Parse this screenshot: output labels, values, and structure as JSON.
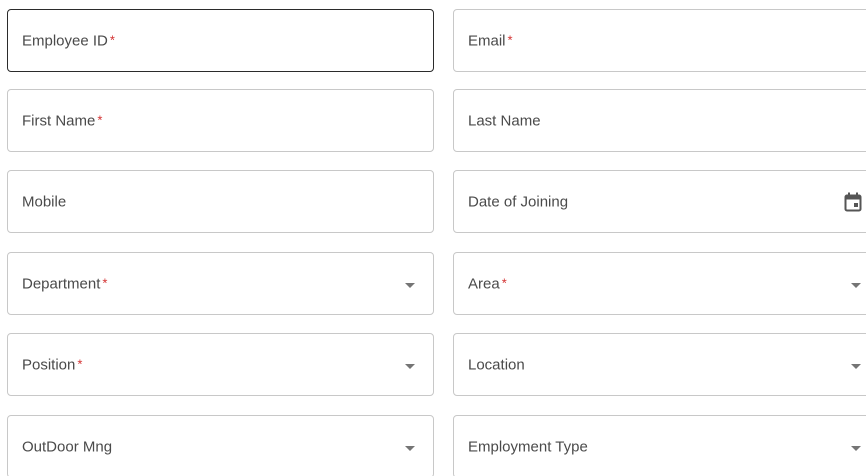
{
  "form": {
    "required_marker": "*",
    "fields": {
      "employee_id": {
        "label": "Employee ID",
        "required": true
      },
      "email": {
        "label": "Email",
        "required": true
      },
      "first_name": {
        "label": "First Name",
        "required": true
      },
      "last_name": {
        "label": "Last Name",
        "required": false
      },
      "mobile": {
        "label": "Mobile",
        "required": false
      },
      "date_of_joining": {
        "label": "Date of Joining",
        "required": false,
        "icon": "calendar-icon"
      },
      "department": {
        "label": "Department",
        "required": true,
        "icon": "dropdown-arrow-icon"
      },
      "area": {
        "label": "Area",
        "required": true,
        "icon": "dropdown-arrow-icon"
      },
      "position": {
        "label": "Position",
        "required": true,
        "icon": "dropdown-arrow-icon"
      },
      "location": {
        "label": "Location",
        "required": false,
        "icon": "dropdown-arrow-icon"
      },
      "outdoor_mng": {
        "label": "OutDoor Mng",
        "required": false,
        "icon": "dropdown-arrow-icon"
      },
      "employment_type": {
        "label": "Employment Type",
        "required": false,
        "icon": "dropdown-arrow-icon"
      }
    }
  },
  "colors": {
    "required": "#d32f2f",
    "border": "#c8c8c8",
    "focused_border": "#2b2b2b",
    "label": "#4a4a4a"
  }
}
